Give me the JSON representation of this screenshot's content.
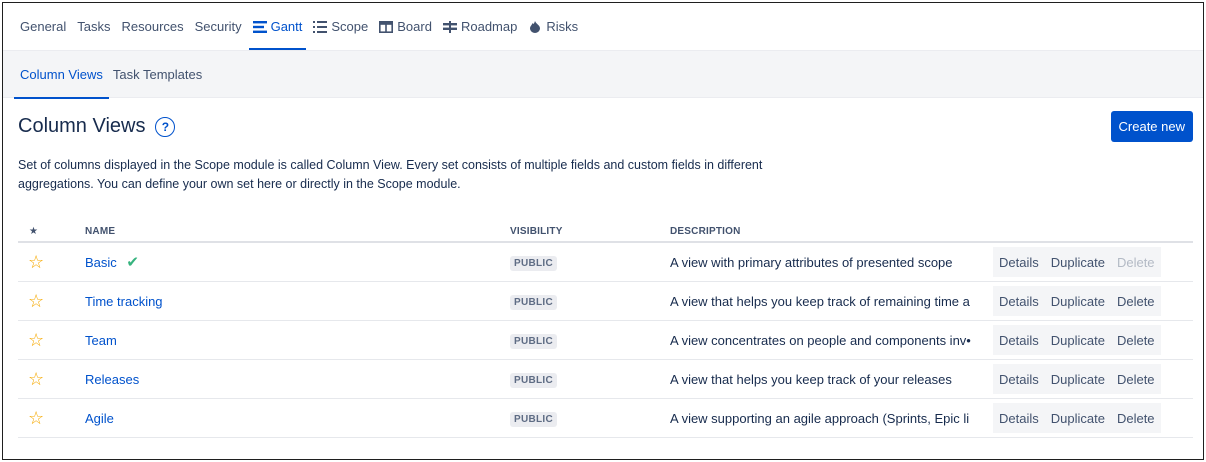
{
  "topnav": [
    {
      "label": "General",
      "icon": null,
      "active": false
    },
    {
      "label": "Tasks",
      "icon": null,
      "active": false
    },
    {
      "label": "Resources",
      "icon": null,
      "active": false
    },
    {
      "label": "Security",
      "icon": null,
      "active": false
    },
    {
      "label": "Gantt",
      "icon": "gantt-icon",
      "active": true
    },
    {
      "label": "Scope",
      "icon": "list-icon",
      "active": false
    },
    {
      "label": "Board",
      "icon": "board-icon",
      "active": false
    },
    {
      "label": "Roadmap",
      "icon": "signpost-icon",
      "active": false
    },
    {
      "label": "Risks",
      "icon": "flame-icon",
      "active": false
    }
  ],
  "subnav": {
    "column_views": "Column Views",
    "task_templates": "Task Templates"
  },
  "header": {
    "title": "Column Views",
    "help": "?",
    "create_label": "Create new"
  },
  "description": "Set of columns displayed in the Scope module is called Column View. Every set consists of multiple fields and custom fields in different aggregations. You can define your own set here or directly in the Scope module.",
  "table": {
    "headers": {
      "star": "★",
      "name": "NAME",
      "visibility": "VISIBILITY",
      "description": "DESCRIPTION"
    },
    "actions": {
      "details": "Details",
      "duplicate": "Duplicate",
      "delete": "Delete"
    },
    "rows": [
      {
        "name": "Basic",
        "default": true,
        "visibility": "PUBLIC",
        "description": "A view with primary attributes of presented scope",
        "delete_disabled": true
      },
      {
        "name": "Time tracking",
        "default": false,
        "visibility": "PUBLIC",
        "description": "A view that helps you keep track of remaining time a",
        "delete_disabled": false
      },
      {
        "name": "Team",
        "default": false,
        "visibility": "PUBLIC",
        "description": "A view concentrates on people and components inv•",
        "delete_disabled": false
      },
      {
        "name": "Releases",
        "default": false,
        "visibility": "PUBLIC",
        "description": "A view that helps you keep track of your releases",
        "delete_disabled": false
      },
      {
        "name": "Agile",
        "default": false,
        "visibility": "PUBLIC",
        "description": "A view supporting an agile approach (Sprints, Epic li",
        "delete_disabled": false
      }
    ]
  },
  "colors": {
    "accent": "#0052cc",
    "star": "#f6a900",
    "check": "#36b37e"
  }
}
